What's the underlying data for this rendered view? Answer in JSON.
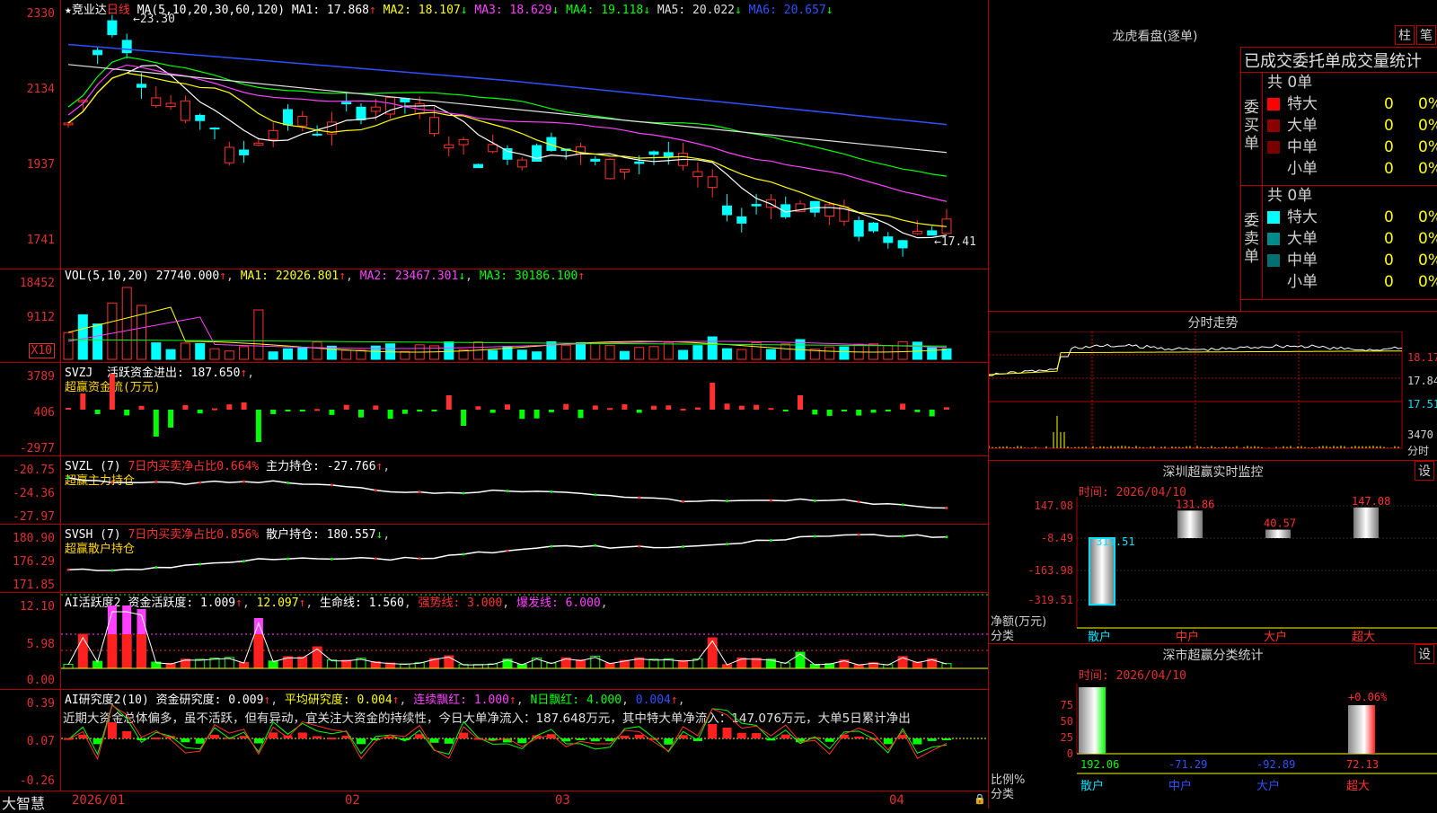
{
  "stock": {
    "name": "竞业达",
    "period": "日线",
    "max_label": "23.30",
    "min_label": "17.41"
  },
  "ma_line": {
    "label": "MA(5,10,20,30,60,120)",
    "ma1": "MA1: 17.868",
    "ma2": "MA2: 18.107",
    "ma3": "MA3: 18.629",
    "ma4": "MA4: 19.118",
    "ma5": "MA5: 20.022",
    "ma6": "MA6: 20.657"
  },
  "axis_main": [
    "2330",
    "2134",
    "1937",
    "1741"
  ],
  "vol": {
    "label": "VOL(5,10,20)",
    "val": "27740.000",
    "ma1": "MA1: 22026.801",
    "ma2": "MA2: 23467.301",
    "ma3": "MA3: 30186.100",
    "axis": [
      "18452",
      "9112"
    ],
    "unit": "X10"
  },
  "svzj": {
    "label": "SVZJ",
    "active": "活跃资金进出: 187.650",
    "sub": "超赢资金流(万元)",
    "axis": [
      "3789",
      "406",
      "-2977"
    ]
  },
  "svzl": {
    "label": "SVZL (7)",
    "ratio": "7日内买卖净占比0.664%",
    "hold": "主力持仓: -27.766",
    "sub": "超赢主力持仓",
    "axis": [
      "-20.75",
      "-24.36",
      "-27.97"
    ]
  },
  "svsh": {
    "label": "SVSH (7)",
    "ratio": "7日内买卖净占比0.856%",
    "hold": "散户持仓: 180.557",
    "sub": "超赢散户持仓",
    "axis": [
      "180.90",
      "176.29",
      "171.85"
    ]
  },
  "ai_active": {
    "label": "AI活跃度2",
    "fund": "资金活跃度: 1.009",
    "v2": "12.097",
    "life": "生命线: 1.560",
    "strong": "强势线: 3.000",
    "burst": "爆发线: 6.000",
    "axis": [
      "12.10",
      "5.98",
      "0.00"
    ]
  },
  "ai_research": {
    "label": "AI研究度2(10)",
    "fund": "资金研究度: 0.009",
    "avg": "平均研究度: 0.004",
    "red": "连续飘红: 1.000",
    "nred": "N日飘红: 4.000",
    "nval": "0.004",
    "comment": "近期大资金总体偏多，虽不活跃，但有异动，宜关注大资金的持续性，今日大单净流入：187.648万元，其中特大单净流入：147.076万元，大单5日累计净出",
    "axis": [
      "0.39",
      "0.07",
      "-0.26"
    ]
  },
  "dates": {
    "brand": "大智慧",
    "d1": "2026/01",
    "d2": "02",
    "d3": "03",
    "d4": "04"
  },
  "dragon": {
    "title": "龙虎看盘(逐单)",
    "btn1": "柱",
    "btn2": "笔",
    "stats_title": "已成交委托单成交量统计",
    "buy": {
      "label": "委买单",
      "total": "共 0单",
      "rows": [
        {
          "name": "特大",
          "count": "0",
          "pct": "0%"
        },
        {
          "name": "大单",
          "count": "0",
          "pct": "0%"
        },
        {
          "name": "中单",
          "count": "0",
          "pct": "0%"
        },
        {
          "name": "小单",
          "count": "0",
          "pct": "0%"
        }
      ]
    },
    "sell": {
      "label": "委卖单",
      "total": "共 0单",
      "rows": [
        {
          "name": "特大",
          "count": "0",
          "pct": "0%"
        },
        {
          "name": "大单",
          "count": "0",
          "pct": "0%"
        },
        {
          "name": "中单",
          "count": "0",
          "pct": "0%"
        },
        {
          "name": "小单",
          "count": "0",
          "pct": "0%"
        }
      ]
    }
  },
  "intraday": {
    "title": "分时走势",
    "labels": [
      "18.17",
      "17.84",
      "17.51",
      "3470",
      "分时"
    ]
  },
  "monitor": {
    "title": "深圳超赢实时监控",
    "btn": "设",
    "time": "时间: 2026/04/10",
    "axis": [
      "147.08",
      "-8.49",
      "-163.98",
      "-319.51"
    ],
    "ylabel": "净额(万元)",
    "xlabel": "分类",
    "cats": [
      "散户",
      "中户",
      "大户",
      "超大"
    ],
    "vals": [
      "-319.51",
      "131.86",
      "40.57",
      "147.08"
    ]
  },
  "classify": {
    "title": "深市超赢分类统计",
    "btn": "设",
    "time": "时间: 2026/04/10",
    "axis": [
      "75",
      "50",
      "25",
      "0"
    ],
    "ylabel": "比例%",
    "xlabel": "分类",
    "cats": [
      "散户",
      "中户",
      "大户",
      "超大"
    ],
    "vals": [
      "192.06",
      "-71.29",
      "-92.89",
      "72.13"
    ],
    "top_label": "+0.06%"
  }
}
